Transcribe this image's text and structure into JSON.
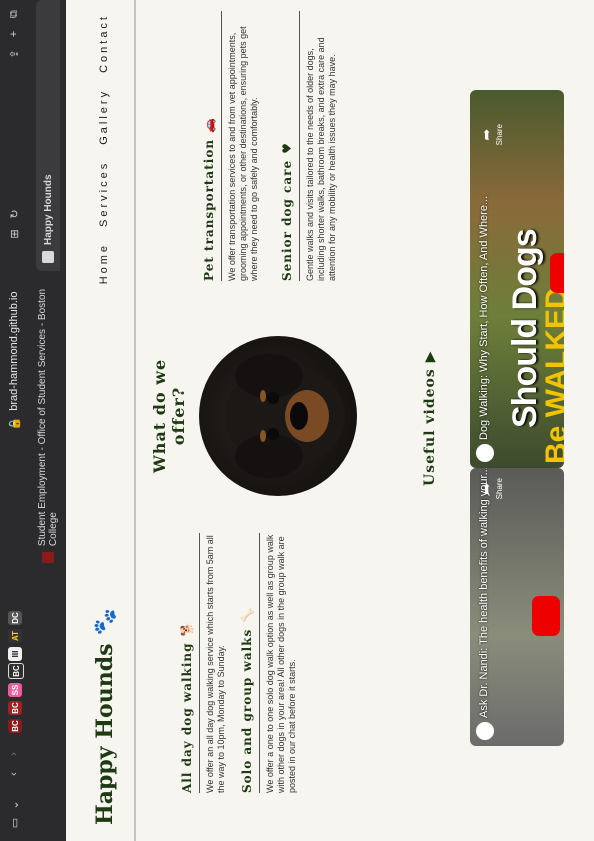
{
  "browser": {
    "url": "brad-hammond.github.io",
    "tabs": [
      {
        "label": "Student Employment - Office of Student Services - Boston College"
      },
      {
        "label": "Happy Hounds"
      }
    ],
    "bookmarks": [
      "BC",
      "BC",
      "SS",
      "BC",
      "III",
      "AT",
      "DC"
    ],
    "icons": [
      "sidebar-icon",
      "chevron-down-icon",
      "back-icon",
      "forward-icon",
      "translate-icon",
      "reload-icon",
      "share-icon",
      "new-tab-icon",
      "tabs-icon"
    ]
  },
  "site": {
    "logo": "Happy Hounds",
    "logo_icon": "paw-icon",
    "nav": [
      "Home",
      "Services",
      "Gallery",
      "Contact"
    ]
  },
  "offer": {
    "title": "What do we offer?",
    "services": [
      {
        "title": "All day dog walking",
        "icon": "dog-icon",
        "text": "We offer an all day dog walking service which starts from 5am all the way to 10pm, Monday to Sunday."
      },
      {
        "title": "Solo and group walks",
        "icon": "bone-icon",
        "text": "We offer a one to one solo dog walk option as well as group walk with other dogs in your area! All other dogs in the group walk are posted in our chat before it starts."
      },
      {
        "title": "Pet transportation",
        "icon": "car-icon",
        "text": "We offer transportation services to and from vet appointments, grooming appointments, or other destinations, ensuring pets get where they need to go safely and comfortably."
      },
      {
        "title": "Senior dog care",
        "icon": "heart-icon",
        "text": "Gentle walks and visits tailored to the needs of older dogs, including shorter walks, bathroom breaks, and extra care and attention for any mobility or health issues they may have."
      }
    ]
  },
  "videos": {
    "title": "Useful videos",
    "items": [
      {
        "title": "Ask Dr. Nandi: The health benefits of walking your...",
        "share": "Share"
      },
      {
        "title": "Dog Walking: Why Start, How Often, And Where...",
        "share": "Share",
        "overlay_line1": "Should Dogs",
        "overlay_line2": "Be WALKED"
      }
    ]
  }
}
